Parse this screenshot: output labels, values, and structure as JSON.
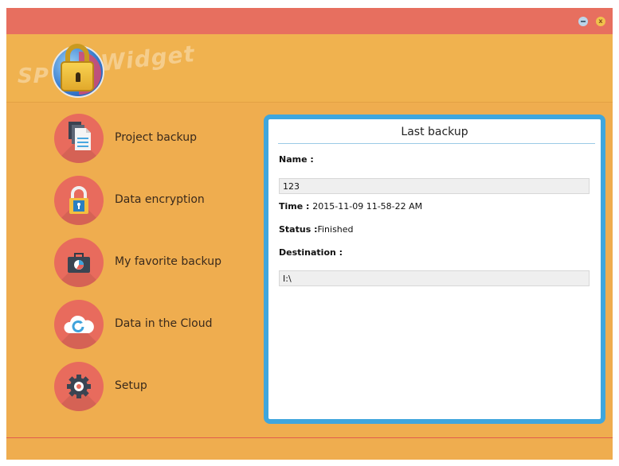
{
  "window": {
    "minimize_icon": "minimize-icon",
    "close_label": "x"
  },
  "logo": {
    "left_text": "SP",
    "right_text": "Widget"
  },
  "sidebar": {
    "items": [
      {
        "label": "Project backup",
        "icon": "documents-icon"
      },
      {
        "label": "Data encryption",
        "icon": "lock-icon"
      },
      {
        "label": "My favorite backup",
        "icon": "briefcase-icon"
      },
      {
        "label": "Data in the Cloud",
        "icon": "cloud-icon"
      },
      {
        "label": "Setup",
        "icon": "gear-icon"
      }
    ]
  },
  "panel": {
    "title": "Last backup",
    "name_label": "Name :",
    "name_value": "123",
    "time_label": "Time :",
    "time_value": "2015-11-09 11-58-22 AM",
    "status_label": "Status :",
    "status_value": "Finished",
    "destination_label": "Destination :",
    "destination_value": "I:\\"
  },
  "colors": {
    "titlebar": "#e76f5f",
    "background": "#efad4f",
    "nav_circle": "#e86b5d",
    "panel_border": "#3fa6dd"
  }
}
